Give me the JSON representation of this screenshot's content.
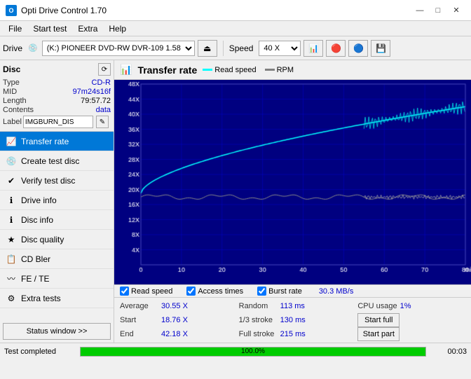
{
  "titleBar": {
    "title": "Opti Drive Control 1.70",
    "icon": "O",
    "minimize": "—",
    "maximize": "□",
    "close": "✕"
  },
  "menuBar": {
    "items": [
      "File",
      "Start test",
      "Extra",
      "Help"
    ]
  },
  "toolbar": {
    "driveLabel": "Drive",
    "driveValue": "(K:)  PIONEER DVD-RW  DVR-109 1.58",
    "speedLabel": "Speed",
    "speedValue": "40 X"
  },
  "disc": {
    "title": "Disc",
    "type": {
      "label": "Type",
      "value": "CD-R"
    },
    "mid": {
      "label": "MID",
      "value": "97m24s16f"
    },
    "length": {
      "label": "Length",
      "value": "79:57.72"
    },
    "contents": {
      "label": "Contents",
      "value": "data"
    },
    "label": {
      "label": "Label",
      "value": "IMGBURN_DIS"
    }
  },
  "navItems": [
    {
      "id": "transfer-rate",
      "label": "Transfer rate",
      "active": true
    },
    {
      "id": "create-test-disc",
      "label": "Create test disc",
      "active": false
    },
    {
      "id": "verify-test-disc",
      "label": "Verify test disc",
      "active": false
    },
    {
      "id": "drive-info",
      "label": "Drive info",
      "active": false
    },
    {
      "id": "disc-info",
      "label": "Disc info",
      "active": false
    },
    {
      "id": "disc-quality",
      "label": "Disc quality",
      "active": false
    },
    {
      "id": "cd-bler",
      "label": "CD Bler",
      "active": false
    },
    {
      "id": "fe-te",
      "label": "FE / TE",
      "active": false
    },
    {
      "id": "extra-tests",
      "label": "Extra tests",
      "active": false
    }
  ],
  "statusWindowBtn": "Status window >>",
  "chart": {
    "title": "Transfer rate",
    "legend": [
      {
        "label": "Read speed",
        "color": "#00ffff"
      },
      {
        "label": "RPM",
        "color": "#808080"
      }
    ],
    "yAxisMax": 48,
    "xAxisMax": 80,
    "xLabel": "min",
    "gridColor": "#0000cc",
    "bgColor": "#000080"
  },
  "checkboxes": {
    "readSpeed": {
      "label": "Read speed",
      "checked": true
    },
    "accessTimes": {
      "label": "Access times",
      "checked": true
    },
    "burstRate": {
      "label": "Burst rate",
      "checked": true
    },
    "burstValue": "30.3 MB/s"
  },
  "stats": {
    "average": {
      "label": "Average",
      "value": "30.55 X"
    },
    "start": {
      "label": "Start",
      "value": "18.76 X"
    },
    "end": {
      "label": "End",
      "value": "42.18 X"
    },
    "random": {
      "label": "Random",
      "value": "113 ms"
    },
    "oneThirdStroke": {
      "label": "1/3 stroke",
      "value": "130 ms"
    },
    "fullStroke": {
      "label": "Full stroke",
      "value": "215 ms"
    },
    "cpuUsage": {
      "label": "CPU usage",
      "value": "1%"
    },
    "startBtn": "Start full",
    "startPartBtn": "Start part"
  },
  "statusBar": {
    "text": "Test completed",
    "progress": 100,
    "progressLabel": "100.0%",
    "time": "00:03"
  }
}
